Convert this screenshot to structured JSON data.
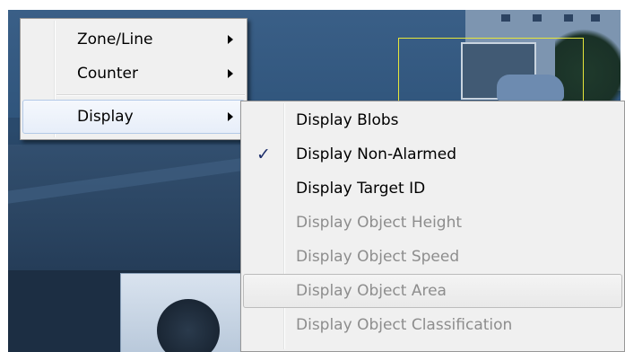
{
  "main_menu": {
    "items": [
      {
        "label": "Zone/Line",
        "has_submenu": true,
        "enabled": true
      },
      {
        "label": "Counter",
        "has_submenu": true,
        "enabled": true
      },
      {
        "label": "Display",
        "has_submenu": true,
        "enabled": true,
        "highlighted": true
      }
    ]
  },
  "display_submenu": {
    "items": [
      {
        "label": "Display Blobs",
        "checked": false,
        "enabled": true
      },
      {
        "label": "Display Non-Alarmed",
        "checked": true,
        "enabled": true
      },
      {
        "label": "Display Target ID",
        "checked": false,
        "enabled": true
      },
      {
        "label": "Display Object Height",
        "checked": false,
        "enabled": false
      },
      {
        "label": "Display Object Speed",
        "checked": false,
        "enabled": false
      },
      {
        "label": "Display Object Area",
        "checked": false,
        "enabled": false,
        "highlighted": true
      },
      {
        "label": "Display Object Classification",
        "checked": false,
        "enabled": false
      }
    ]
  },
  "icons": {
    "check_glyph": "✓",
    "submenu_arrow": "chevron-right-icon"
  },
  "colors": {
    "detection_box": "#e6e63a",
    "menu_background": "#f0f0f0",
    "disabled_text": "#8d8d8d",
    "hover_border": "#b3c9e7"
  }
}
